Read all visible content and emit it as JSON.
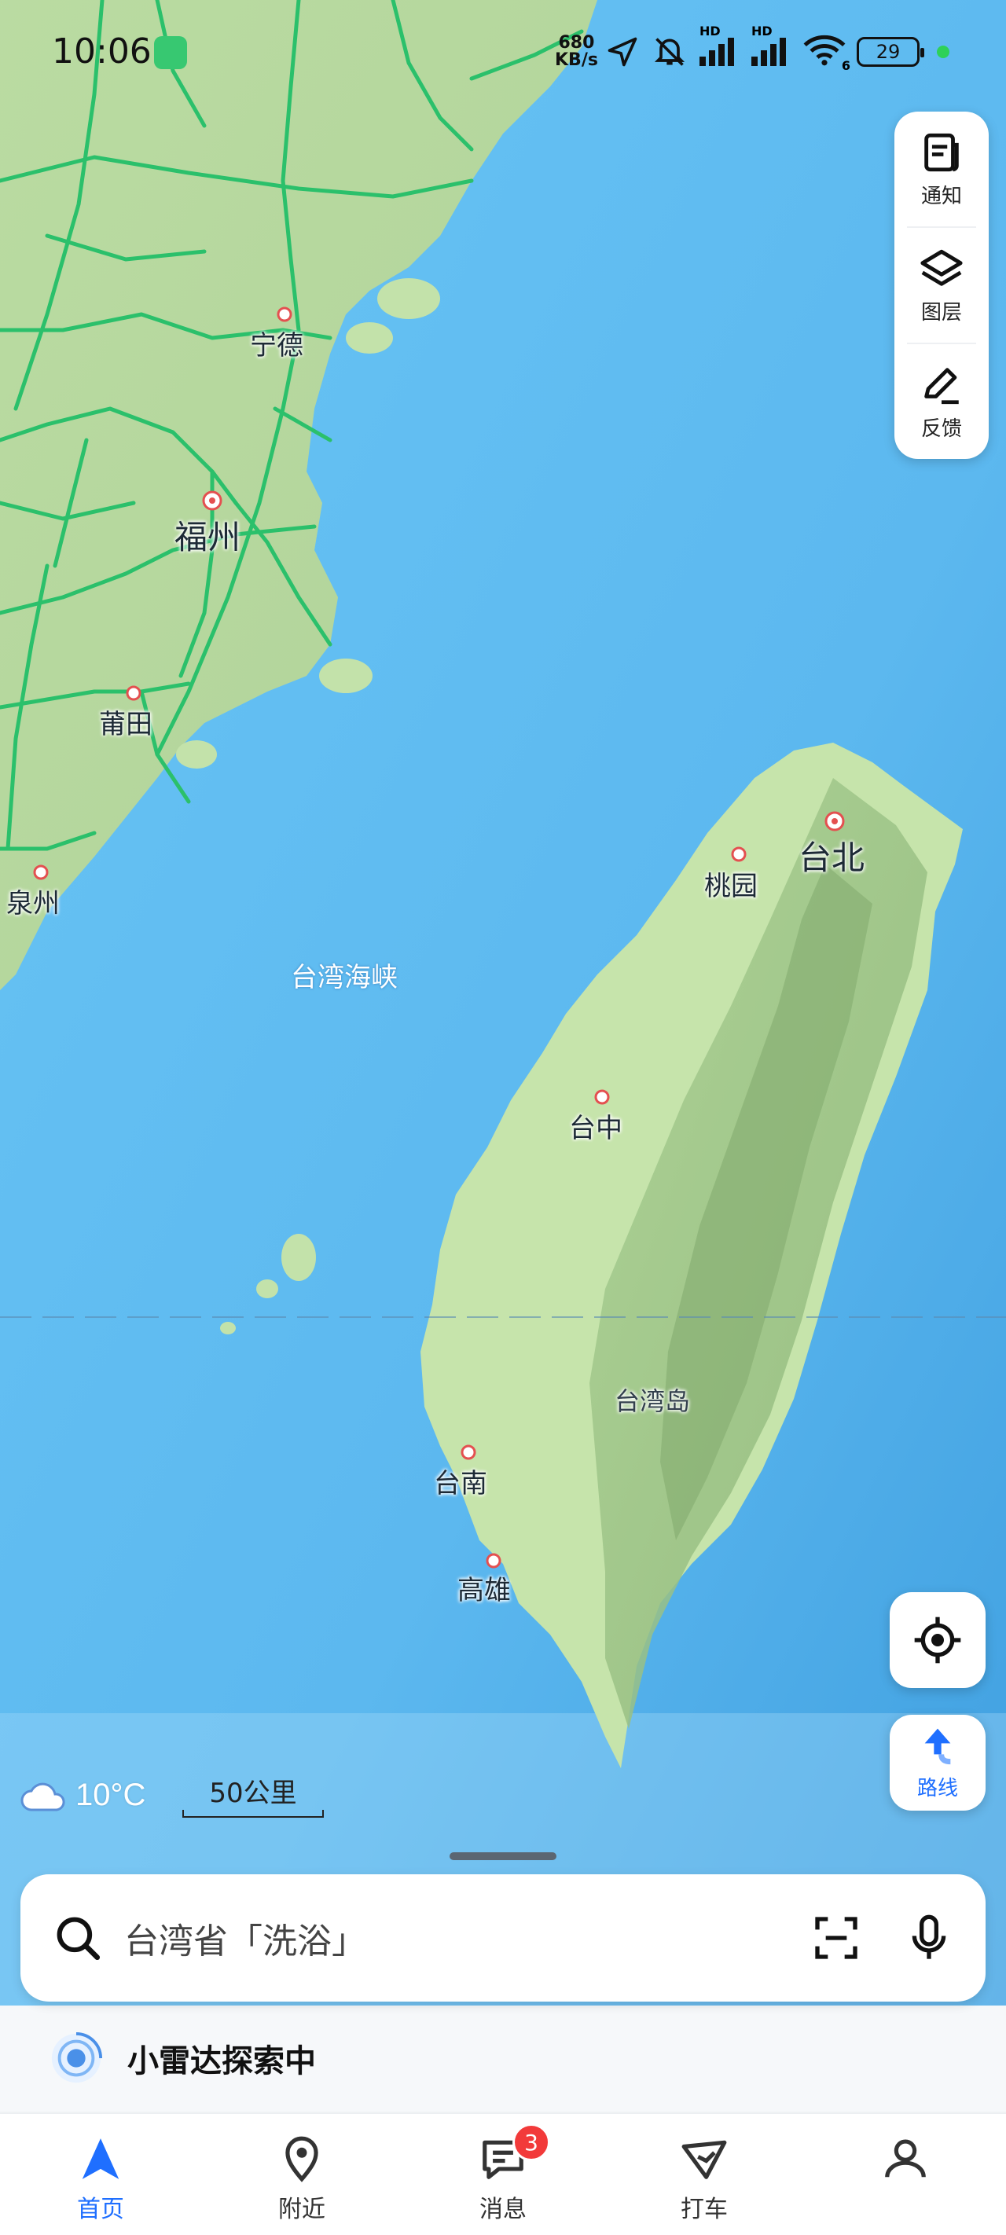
{
  "status_bar": {
    "time": "10:06",
    "net_speed_value": "680",
    "net_speed_unit": "KB/s",
    "hd1": "HD",
    "hd2": "HD",
    "wifi_level": "6",
    "battery": "29"
  },
  "map": {
    "cities": [
      "宁德",
      "福州",
      "莆田",
      "泉州",
      "台北",
      "桃园",
      "台中",
      "台南",
      "高雄"
    ],
    "sea_label": "台湾海峡",
    "island_label": "台湾岛"
  },
  "tools": {
    "notify": "通知",
    "layers": "图层",
    "feedback": "反馈"
  },
  "route_label": "路线",
  "weather": {
    "temp": "10°C"
  },
  "scale": {
    "label": "50公里"
  },
  "search": {
    "placeholder": "台湾省「洗浴」"
  },
  "radar": {
    "label": "小雷达探索中"
  },
  "nav": {
    "items": [
      "首页",
      "附近",
      "消息",
      "打车"
    ],
    "messages_badge": "3",
    "active_color": "#1f6fff"
  },
  "colors": {
    "sea": "#5fbdf2",
    "land": "#bfe0a8",
    "road": "#2bc06b"
  }
}
